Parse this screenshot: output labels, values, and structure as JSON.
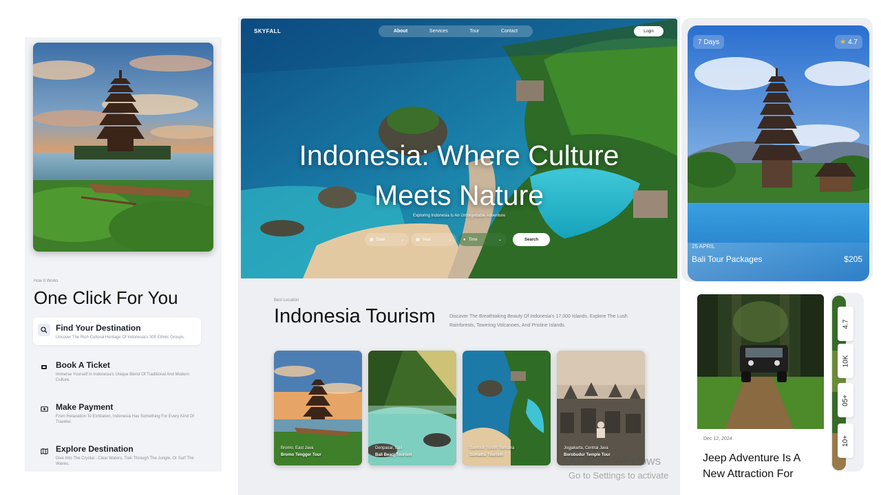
{
  "left": {
    "eyebrow": "How It Works",
    "title": "One Click For You",
    "steps": [
      {
        "title": "Find Your Destination",
        "desc": "Uncover The Rich Cultural Heritage Of Indonesia's 300 Ethnic Groups.",
        "icon": "search-icon"
      },
      {
        "title": "Book A Ticket",
        "desc": "Immerse Yourself In Indonesia's Unique Blend Of Traditional And Modern Culture.",
        "icon": "ticket-icon"
      },
      {
        "title": "Make Payment",
        "desc": "From Relaxation To Exhilation, Indonesia Has Something For Every Kind Of Traveler.",
        "icon": "money-icon"
      },
      {
        "title": "Explore Destination",
        "desc": "Dive Into The Crystal - Clear Waters, Trek Through The Jungle, Or Surf The Waves.",
        "icon": "map-icon"
      }
    ]
  },
  "center": {
    "brand": "SKYFALL",
    "nav": [
      "About",
      "Services",
      "Tour",
      "Contact"
    ],
    "login": "Login",
    "hero_title": "Indonesia: Where Culture Meets Nature",
    "hero_sub": "Exploring Indonesia Is An Unforgettable Adventure",
    "search_fields": [
      "Date",
      "Year",
      "Time"
    ],
    "search_button": "Search",
    "section_eyebrow": "Best Location",
    "section_title": "Indonesia Tourism",
    "section_desc": "Discover The Breathtaking Beauty Of Indonesia's 17,000 Islands. Explore The Lush Rainforests, Towering Volcanoes, And Pristine Islands.",
    "cards": [
      {
        "location": "Bromo, East Java",
        "name": "Bromo Tengger Tour"
      },
      {
        "location": "Denpasar, Bali",
        "name": "Bali Beacj Tourism"
      },
      {
        "location": "Samosir, South Sumatra",
        "name": "Sumatra Tourism"
      },
      {
        "location": "Jogjakarta, Central Java",
        "name": "Borobudur Temple Tour"
      }
    ]
  },
  "watermark": {
    "line1": "Activate Windows",
    "line2": "Go to Settings to activate"
  },
  "tour_card": {
    "duration": "7 Days",
    "rating": "4.7",
    "date": "25 APRIL",
    "name": "Bali Tour Packages",
    "price": "$205"
  },
  "blog": {
    "date": "Dec 12, 2024",
    "title": "Jeep Adventure Is A New Attraction For"
  },
  "stats": [
    "4.7",
    "10K",
    "05+",
    "10+"
  ],
  "colors": {
    "accent": "#1a1d24",
    "panel": "#f2f3f6",
    "star": "#f6c21c"
  }
}
